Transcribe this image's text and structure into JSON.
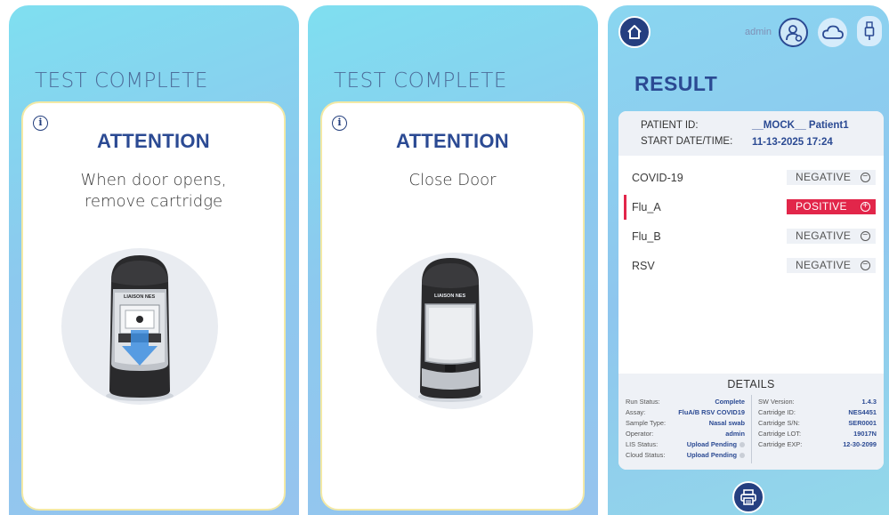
{
  "screens": [
    {
      "header": "TEST COMPLETE",
      "attention": "ATTENTION",
      "instruction": "When door opens,\nremove cartridge",
      "device_brand": "LIAISON NES"
    },
    {
      "header": "TEST COMPLETE",
      "attention": "ATTENTION",
      "instruction": "Close Door",
      "device_brand": "LIAISON NES"
    }
  ],
  "result": {
    "user": "admin",
    "title": "RESULT",
    "patient_id_label": "PATIENT ID:",
    "patient_id": "__MOCK__ Patient1",
    "start_label": "START DATE/TIME:",
    "start_value": "11-13-2025 17:24",
    "results": [
      {
        "name": "COVID-19",
        "value": "NEGATIVE",
        "status": "negative"
      },
      {
        "name": "Flu_A",
        "value": "POSITIVE",
        "status": "positive"
      },
      {
        "name": "Flu_B",
        "value": "NEGATIVE",
        "status": "negative"
      },
      {
        "name": "RSV",
        "value": "NEGATIVE",
        "status": "negative"
      }
    ],
    "details_title": "DETAILS",
    "details_left": [
      {
        "key": "Run Status:",
        "value": "Complete"
      },
      {
        "key": "Assay:",
        "value": "FluA/B RSV COVID19"
      },
      {
        "key": "Sample Type:",
        "value": "Nasal swab"
      },
      {
        "key": "Operator:",
        "value": "admin"
      },
      {
        "key": "LIS Status:",
        "value": "Upload Pending"
      },
      {
        "key": "Cloud Status:",
        "value": "Upload Pending"
      }
    ],
    "details_right": [
      {
        "key": "SW Version:",
        "value": "1.4.3"
      },
      {
        "key": "Cartridge ID:",
        "value": "NES4451"
      },
      {
        "key": "Cartridge S/N:",
        "value": "SER0001"
      },
      {
        "key": "Cartridge LOT:",
        "value": "19017N"
      },
      {
        "key": "Cartridge EXP:",
        "value": "12-30-2099"
      }
    ]
  },
  "colors": {
    "accent_blue": "#2b4a93",
    "positive_red": "#e2264a",
    "card_border": "#f3e9a6"
  },
  "icons": [
    "info-icon",
    "home-icon",
    "user-settings-icon",
    "cloud-icon",
    "usb-icon",
    "print-icon",
    "minus-circle-icon",
    "plus-circle-icon",
    "down-arrow-icon"
  ]
}
